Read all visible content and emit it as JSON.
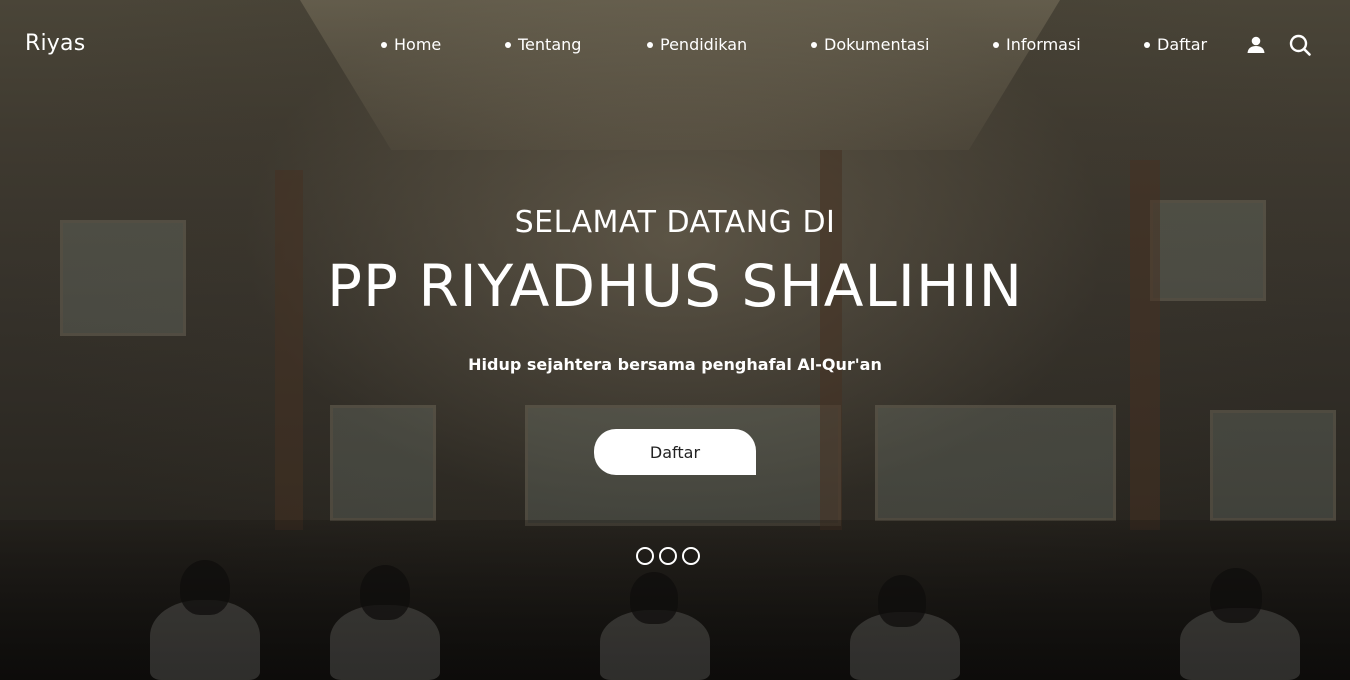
{
  "brand": "Riyas",
  "nav": {
    "items": [
      {
        "label": "Home"
      },
      {
        "label": "Tentang"
      },
      {
        "label": "Pendidikan"
      },
      {
        "label": "Dokumentasi"
      },
      {
        "label": "Informasi"
      },
      {
        "label": "Daftar"
      }
    ],
    "icons": [
      "user-icon",
      "search-icon"
    ]
  },
  "hero": {
    "subtitle": "SELAMAT DATANG DI",
    "title": "PP RIYADHUS SHALIHIN",
    "tagline": "Hidup sejahtera bersama penghafal Al-Qur'an",
    "cta_label": "Daftar",
    "slides": 3
  },
  "colors": {
    "text": "#ffffff",
    "button_bg": "#ffffff",
    "button_text": "#222222"
  }
}
